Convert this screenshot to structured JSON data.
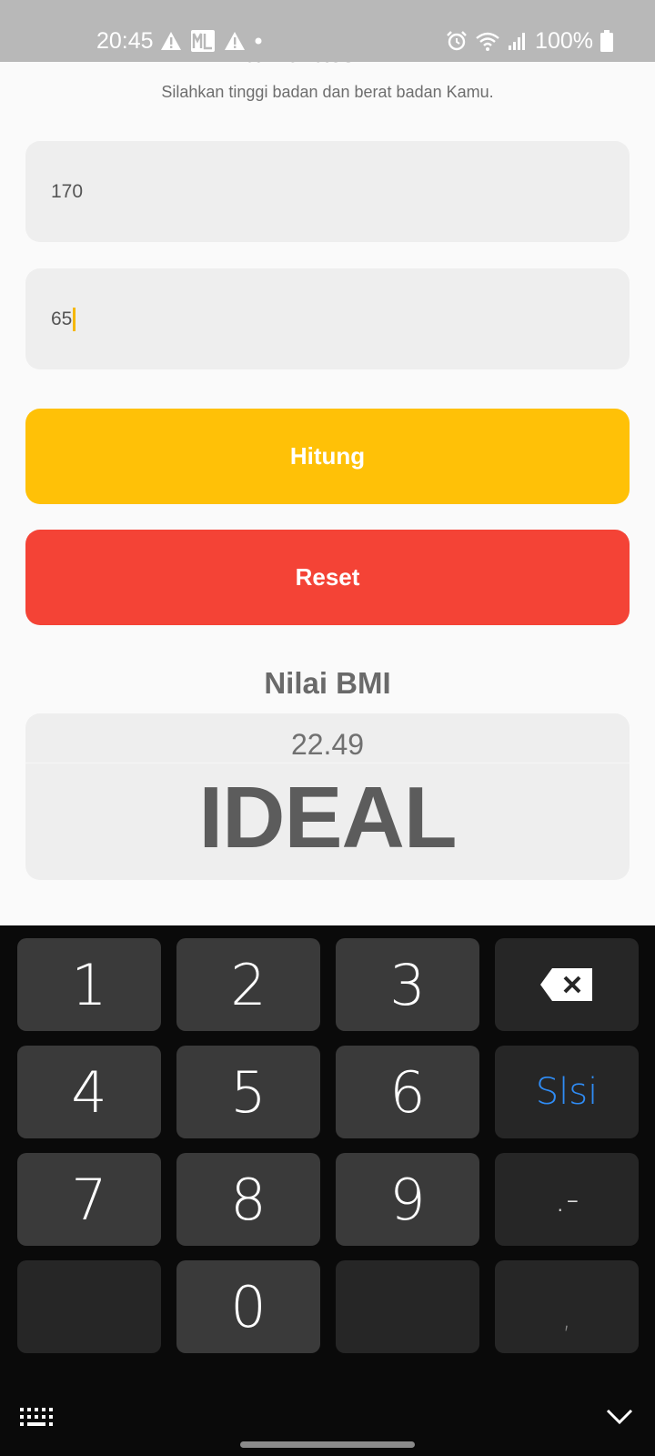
{
  "status_bar": {
    "time": "20:45",
    "battery": "100%",
    "icons": [
      "alert-icon",
      "ml-icon",
      "alert-icon",
      "dot-icon",
      "alarm-icon",
      "wifi-icon",
      "signal-icon",
      "battery-icon"
    ]
  },
  "app": {
    "title": "Kalkulator BMI",
    "subtitle": "Silahkan tinggi badan dan berat badan Kamu.",
    "height_value": "170",
    "weight_value": "65",
    "calculate_label": "Hitung",
    "reset_label": "Reset",
    "result_heading": "Nilai BMI",
    "bmi_value": "22.49",
    "bmi_category": "IDEAL",
    "colors": {
      "calculate": "#ffc107",
      "reset": "#f44336",
      "caret": "#f5b800"
    }
  },
  "keyboard": {
    "keys": {
      "k1": "1",
      "k2": "2",
      "k3": "3",
      "k4": "4",
      "k5": "5",
      "k6": "6",
      "k7": "7",
      "k8": "8",
      "k9": "9",
      "k0": "0",
      "done": "Slsi",
      "punct": ".-",
      "comma": ","
    },
    "accent_color": "#2f8cf5"
  }
}
